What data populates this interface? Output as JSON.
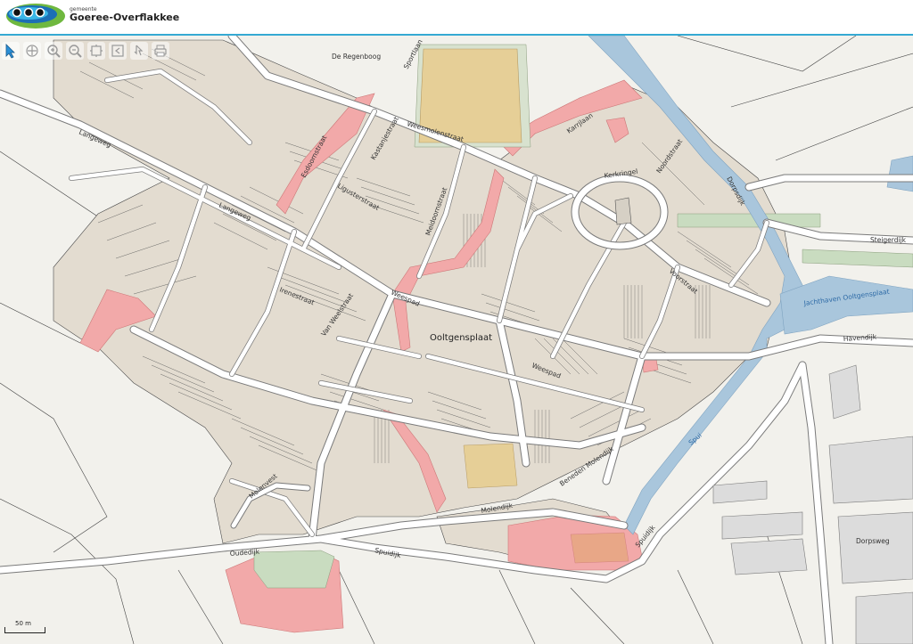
{
  "header": {
    "municipality_small": "gemeente",
    "municipality_name": "Goeree-Overflakkee"
  },
  "toolbar": {
    "tools": [
      "pointer-icon",
      "pan-icon",
      "zoom-in-icon",
      "zoom-out-icon",
      "full-extent-icon",
      "previous-extent-icon",
      "identify-icon",
      "print-icon"
    ]
  },
  "scalebar": {
    "label": "50 m"
  },
  "map": {
    "colors": {
      "background": "#f2f1ec",
      "parcel_fill": "#e3dcd0",
      "street": "#ffffff",
      "water": "#a9c6dc",
      "green": "#c9dcc0",
      "red_zone": "#f2a9a9",
      "sports_field": "#e6cf97"
    },
    "labels": {
      "de_regenboog": "De Regenboog",
      "sportlaan": "Sportlaan",
      "weesmolenstraat": "Weesmolenstraat",
      "langeweg_1": "Langeweg",
      "langeweg_2": "Langeweg",
      "kerkring": "Kerkringel",
      "karrjlaan": "Karrjlaan",
      "voorstraat": "Voorstraat",
      "noordstraat": "Noordstraat",
      "dorpsdijk": "Dorpsdijk",
      "steigerdijk": "Steigerdijk",
      "jachthaven": "Jachthaven Ooltgensplaat",
      "havendijk": "Havendijk",
      "ooltgensplaat": "Ooltgensplaat",
      "weespad_1": "Weespad",
      "weespad_2": "Weespad",
      "irenestraat": "Irenestraat",
      "van_weelstraat": "Van Weelstraat",
      "beneden_molendijk": "Beneden Molendijk",
      "molendijk": "Molendijk",
      "spuidijk_1": "Spuidijk",
      "spuidijk_2": "Spuidijk",
      "spui": "Spui",
      "dorpsweg": "Dorpsweg",
      "oudedijk": "Oudedijk",
      "molenvest": "Molenvest",
      "kastanjestraat": "Kastanjestraat",
      "esdoornstraat": "Esdoornstraat",
      "ligusterstraat": "Ligusterstraat",
      "meidoornstraat": "Meidoornstraat"
    }
  }
}
